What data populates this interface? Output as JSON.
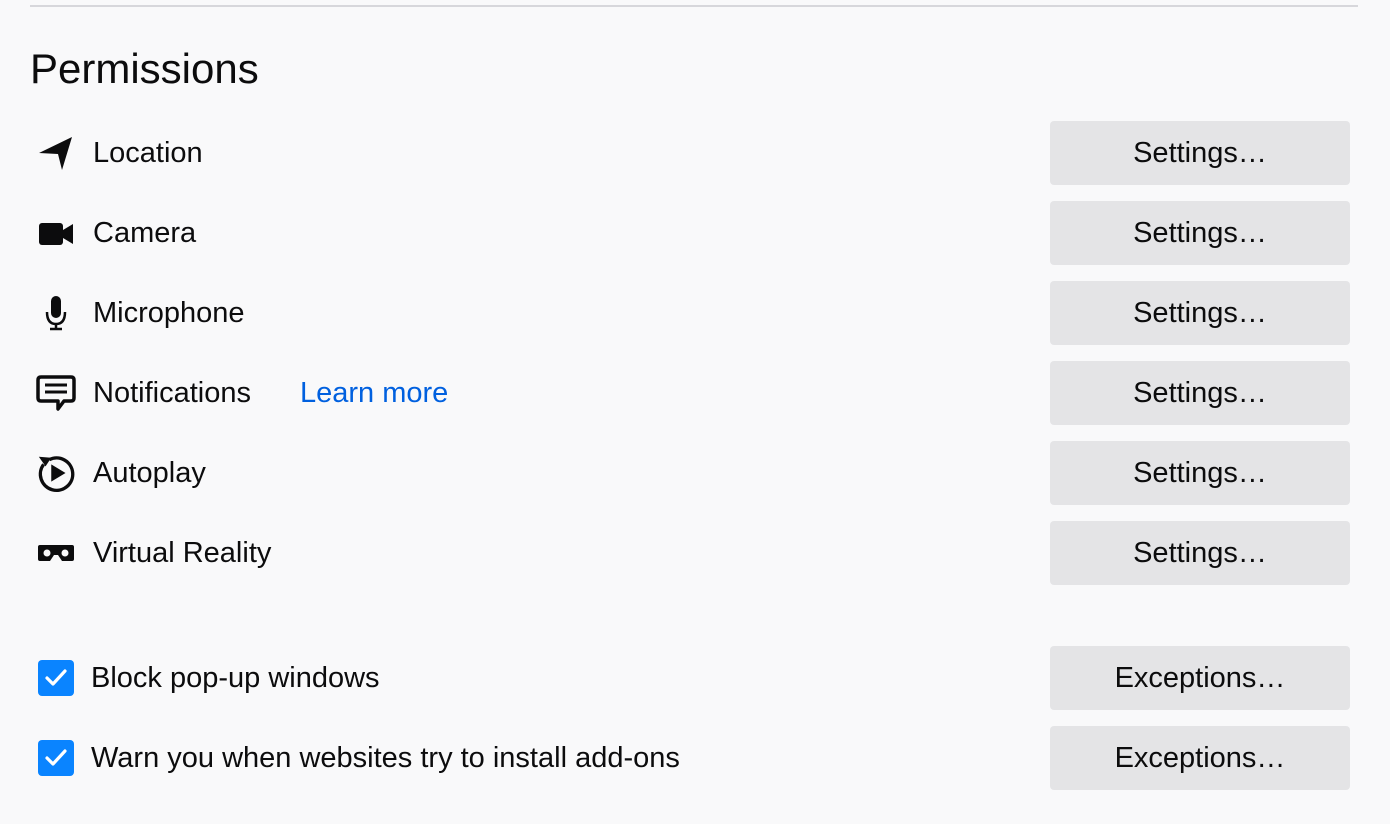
{
  "section": {
    "title": "Permissions"
  },
  "permissions": [
    {
      "label": "Location",
      "button": "Settings…",
      "icon": "location-arrow-icon"
    },
    {
      "label": "Camera",
      "button": "Settings…",
      "icon": "camera-icon"
    },
    {
      "label": "Microphone",
      "button": "Settings…",
      "icon": "microphone-icon"
    },
    {
      "label": "Notifications",
      "button": "Settings…",
      "icon": "notification-bubble-icon",
      "link": "Learn more"
    },
    {
      "label": "Autoplay",
      "button": "Settings…",
      "icon": "autoplay-icon"
    },
    {
      "label": "Virtual Reality",
      "button": "Settings…",
      "icon": "vr-headset-icon"
    }
  ],
  "checks": [
    {
      "label": "Block pop-up windows",
      "checked": true,
      "button": "Exceptions…"
    },
    {
      "label": "Warn you when websites try to install add-ons",
      "checked": true,
      "button": "Exceptions…"
    }
  ],
  "colors": {
    "background": "#f9f9fa",
    "button": "#e4e4e6",
    "link": "#0060df",
    "checkbox": "#0a84ff"
  }
}
